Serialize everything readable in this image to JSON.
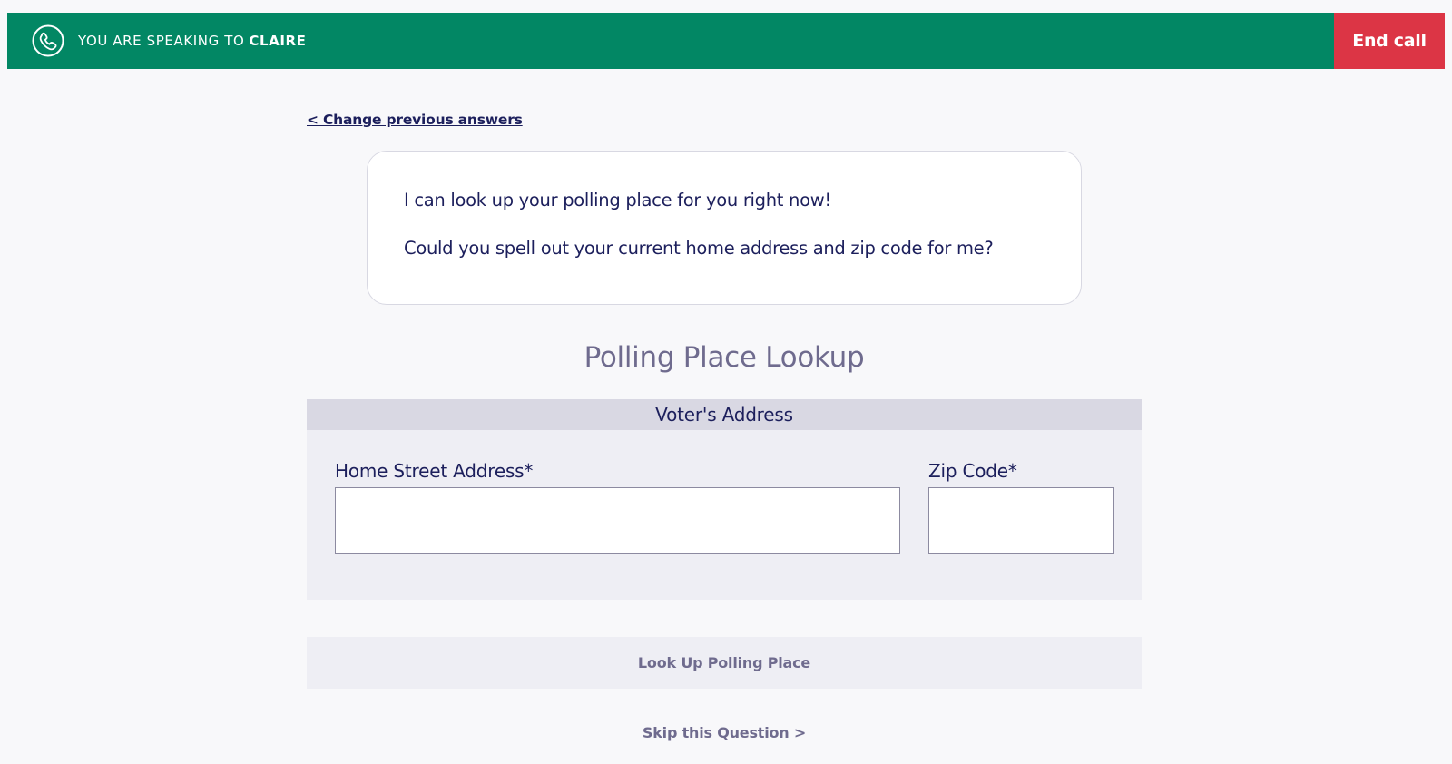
{
  "topbar": {
    "speaking_label": "YOU ARE SPEAKING TO",
    "contact_name": "CLAIRE",
    "end_call_label": "End call",
    "icon": "phone-icon",
    "color": "#028764",
    "end_call_color": "#dc3545"
  },
  "nav": {
    "back_label": "< Change previous answers"
  },
  "script": {
    "line1": "I can look up your polling place for you right now!",
    "line2": "Could you spell out your current home address and zip code for me?"
  },
  "lookup": {
    "title": "Polling Place Lookup",
    "section_header": "Voter's Address",
    "address_label": "Home Street Address*",
    "address_value": "",
    "zip_label": "Zip Code*",
    "zip_value": "",
    "submit_label": "Look Up Polling Place",
    "skip_label": "Skip this Question >"
  }
}
